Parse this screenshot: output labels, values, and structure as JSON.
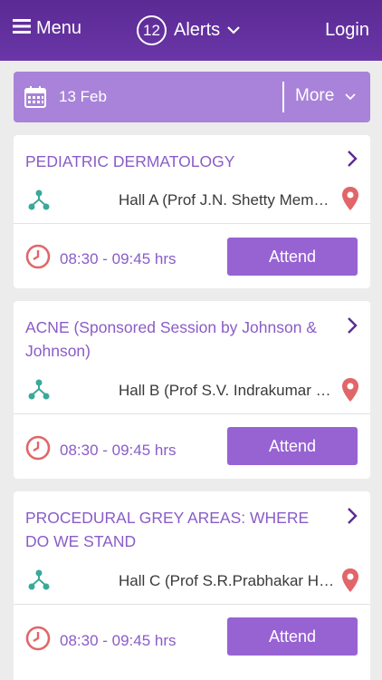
{
  "header": {
    "menu_label": "Menu",
    "alerts_count": "12",
    "alerts_label": "Alerts",
    "login_label": "Login"
  },
  "datebar": {
    "date": "13 Feb",
    "more_label": "More"
  },
  "sessions": [
    {
      "title": "PEDIATRIC DERMATOLOGY",
      "hall": "Hall A (Prof J.N. Shetty Memorial Hall)",
      "time": "08:30 - 09:45 hrs",
      "attend_label": "Attend"
    },
    {
      "title": "ACNE (Sponsored Session by Johnson & Johnson)",
      "hall": "Hall B (Prof S.V. Indrakumar Hall)",
      "time": "08:30 - 09:45 hrs",
      "attend_label": "Attend"
    },
    {
      "title": "PROCEDURAL GREY AREAS: WHERE DO WE STAND",
      "hall": "Hall C (Prof S.R.Prabhakar Hall)",
      "time": "08:30 - 09:45 hrs",
      "attend_label": "Attend"
    }
  ],
  "colors": {
    "header": "#5b2a93",
    "datebar": "#a883d9",
    "accent_text": "#8a5cc8",
    "button": "#9763d3",
    "network_icon": "#3aa99a",
    "pin_icon": "#e0666a",
    "clock_icon": "#e0666a"
  },
  "icons": [
    "hamburger-icon",
    "chevron-down-icon",
    "calendar-icon",
    "chevron-right-icon",
    "network-icon",
    "map-pin-icon",
    "clock-icon"
  ]
}
